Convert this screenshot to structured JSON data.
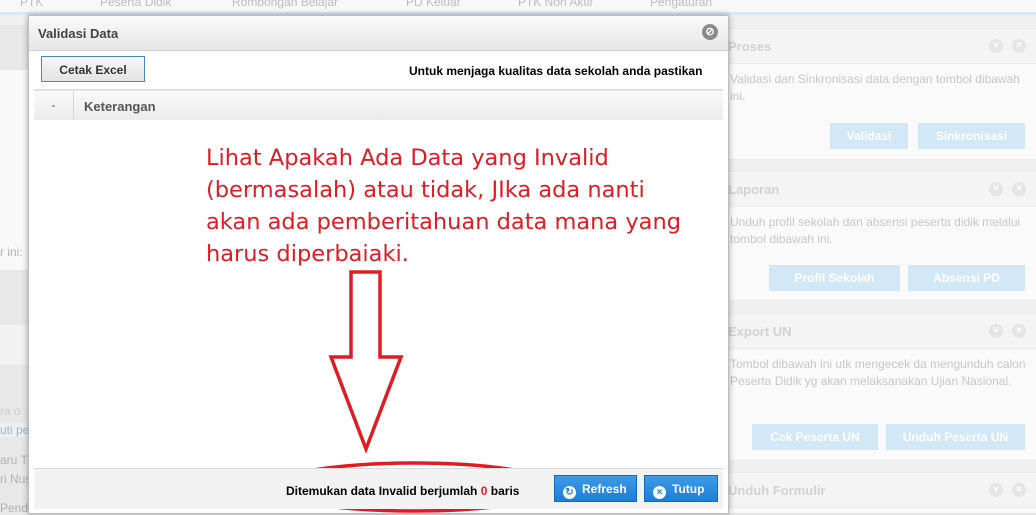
{
  "background": {
    "top_nav": [
      "PTK",
      "Peserta Didik",
      "Rombongan Belajar",
      "PD Keluar",
      "PTK Non Aktif",
      "Pengaturan"
    ],
    "left_fragments": [
      "r ini:",
      "ra o",
      "uti pe",
      "aru T",
      "ri Nus",
      "Pend"
    ],
    "panels": [
      {
        "title": "Proses",
        "text": "Validasi dan Sinkronisasi data dengan tombol dibawah ini.",
        "buttons": [
          "Validasi",
          "Sinkronisasi"
        ]
      },
      {
        "title": "Laporan",
        "text": "Unduh profil sekolah dan absensi peserta didik melalui tombol dibawah ini.",
        "buttons": [
          "Profil Sekolah",
          "Absensi PD"
        ]
      },
      {
        "title": "Export UN",
        "text": "Tombol dibawah ini utk mengecek da mengunduh calon Peserta Didik yg akan melaksanakan Ujian Nasional.",
        "buttons": [
          "Cek Peserta UN",
          "Unduh Peserta UN"
        ]
      },
      {
        "title": "Unduh Formulir",
        "text": "",
        "buttons": []
      }
    ]
  },
  "dialog": {
    "title": "Validasi Data",
    "excel_button": "Cetak Excel",
    "toolbar_message": "Untuk menjaga kualitas data sekolah anda pastikan",
    "columns": [
      "-",
      "Keterangan"
    ],
    "annotation": "Lihat Apakah Ada Data yang Invalid (bermasalah) atau tidak, JIka ada nanti akan ada pemberitahuan data mana yang harus diperbaiaki.",
    "footer": {
      "prefix": "Ditemukan data Invalid berjumlah",
      "count": "0",
      "suffix": "baris"
    },
    "refresh_button": "Refresh",
    "close_button": "Tutup"
  },
  "colors": {
    "annotation": "#e11b22",
    "primary_button": "#1b7fd6"
  }
}
